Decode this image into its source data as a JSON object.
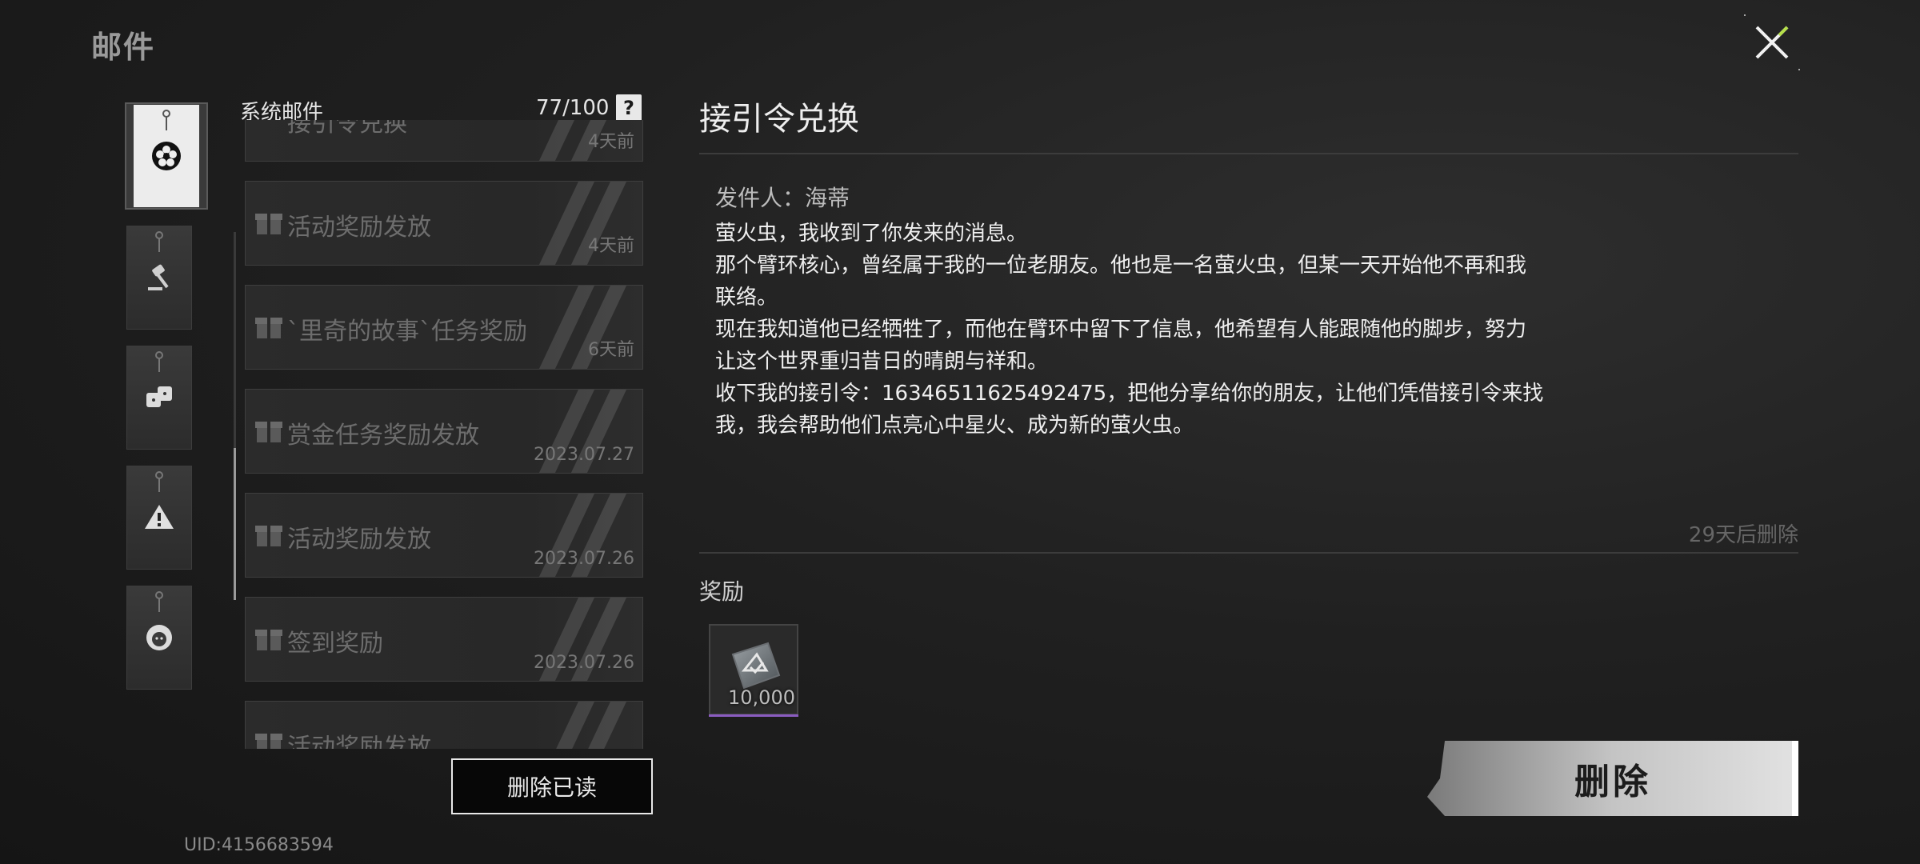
{
  "page_title": "邮件",
  "list": {
    "title": "系统邮件",
    "count": "77/100",
    "help": "?",
    "items": [
      {
        "subject": "接引令兑换",
        "date": "4天前"
      },
      {
        "subject": "活动奖励发放",
        "date": "4天前"
      },
      {
        "subject": "`里奇的故事`任务奖励",
        "date": "6天前"
      },
      {
        "subject": "赏金任务奖励发放",
        "date": "2023.07.27"
      },
      {
        "subject": "活动奖励发放",
        "date": "2023.07.26"
      },
      {
        "subject": "签到奖励",
        "date": "2023.07.26"
      },
      {
        "subject": "活动奖励发放",
        "date": ""
      }
    ],
    "delete_read": "删除已读"
  },
  "uid": "UID:4156683594",
  "detail": {
    "title": "接引令兑换",
    "sender": "发件人：海蒂",
    "body": [
      "萤火虫，我收到了你发来的消息。",
      "那个臂环核心，曾经属于我的一位老朋友。他也是一名萤火虫，但某一天开始他不再和我",
      "联络。",
      "现在我知道他已经牺牲了，而他在臂环中留下了信息，他希望有人能跟随他的脚步，努力",
      "让这个世界重归昔日的晴朗与祥和。",
      "收下我的接引令：16346511625492475，把他分享给你的朋友，让他们凭借接引令来找",
      "我，我会帮助他们点亮心中星火、成为新的萤火虫。"
    ],
    "expire": "29天后删除",
    "reward_label": "奖励",
    "reward_qty": "10,000",
    "delete": "删除"
  },
  "colors": {
    "accent_green": "#b6e04a",
    "reward_bar": "#8a5cc0"
  }
}
